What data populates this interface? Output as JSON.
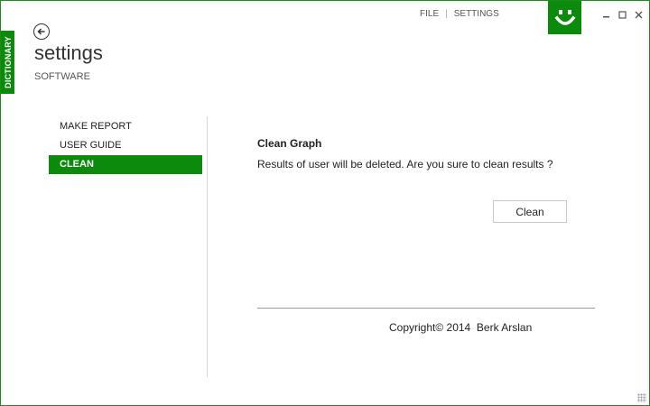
{
  "side_tab": {
    "label": "DICTIONARY"
  },
  "top_menu": {
    "file_label": "FILE",
    "separator": "|",
    "settings_label": "SETTINGS"
  },
  "window_controls": {
    "minimize": "–",
    "maximize": "□",
    "close": "×"
  },
  "header": {
    "title": "settings",
    "subtitle": "SOFTWARE"
  },
  "nav": {
    "items": [
      {
        "label": "MAKE REPORT",
        "active": false
      },
      {
        "label": "USER GUIDE",
        "active": false
      },
      {
        "label": "CLEAN",
        "active": true
      }
    ]
  },
  "content": {
    "section_title": "Clean Graph",
    "description": "Results of user will be deleted. Are you sure to clean results ?",
    "clean_button_label": "Clean",
    "copyright": "Copyright© 2014  Berk Arslan"
  },
  "colors": {
    "accent": "#0c8a0c",
    "border": "#1e8a1e"
  },
  "icons": {
    "back": "arrow-left-circle-icon",
    "logo": "smiley-icon"
  }
}
